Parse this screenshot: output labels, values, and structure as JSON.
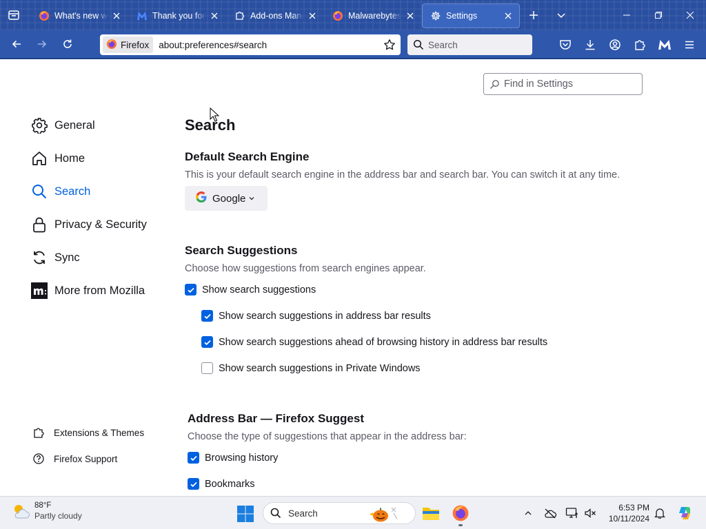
{
  "tabs": [
    {
      "title": "What's new with Firefox",
      "icon": "firefox-icon",
      "active": false
    },
    {
      "title": "Thank you for downloading",
      "icon": "malwarebytes-icon",
      "active": false
    },
    {
      "title": "Add-ons Manager",
      "icon": "puzzle-icon",
      "active": false
    },
    {
      "title": "Malwarebytes Browser Guard",
      "icon": "firefox-icon",
      "active": false
    },
    {
      "title": "Settings",
      "icon": "gear-icon",
      "active": true
    }
  ],
  "urlbar": {
    "identity_label": "Firefox",
    "url": "about:preferences#search"
  },
  "searchbar": {
    "placeholder": "Search"
  },
  "find_in_settings": {
    "placeholder": "Find in Settings"
  },
  "sidebar": {
    "categories": [
      {
        "label": "General",
        "icon": "gear-icon"
      },
      {
        "label": "Home",
        "icon": "home-icon"
      },
      {
        "label": "Search",
        "icon": "search-icon",
        "selected": true
      },
      {
        "label": "Privacy & Security",
        "icon": "lock-icon"
      },
      {
        "label": "Sync",
        "icon": "sync-icon"
      },
      {
        "label": "More from Mozilla",
        "icon": "mozilla-icon"
      }
    ],
    "footer": [
      {
        "label": "Extensions & Themes",
        "icon": "puzzle-icon"
      },
      {
        "label": "Firefox Support",
        "icon": "help-icon"
      }
    ]
  },
  "main": {
    "title": "Search",
    "default_engine": {
      "heading": "Default Search Engine",
      "description": "This is your default search engine in the address bar and search bar. You can switch it at any time.",
      "selected": "Google"
    },
    "suggestions": {
      "heading": "Search Suggestions",
      "description": "Choose how suggestions from search engines appear.",
      "options": [
        {
          "label": "Show search suggestions",
          "checked": true
        },
        {
          "label": "Show search suggestions in address bar results",
          "checked": true
        },
        {
          "label": "Show search suggestions ahead of browsing history in address bar results",
          "checked": true
        },
        {
          "label": "Show search suggestions in Private Windows",
          "checked": false
        }
      ]
    },
    "address_bar": {
      "heading": "Address Bar — Firefox Suggest",
      "description": "Choose the type of suggestions that appear in the address bar:",
      "options": [
        {
          "label": "Browsing history",
          "checked": true
        },
        {
          "label": "Bookmarks",
          "checked": true
        }
      ]
    }
  },
  "taskbar": {
    "weather": {
      "temp": "88°F",
      "condition": "Partly cloudy"
    },
    "search_placeholder": "Search",
    "clock": {
      "time": "6:53 PM",
      "date": "10/11/2024"
    }
  },
  "colors": {
    "accent": "#0061e0",
    "tabstrip": "#2a4fa0",
    "toolbar": "#2f58ad"
  }
}
